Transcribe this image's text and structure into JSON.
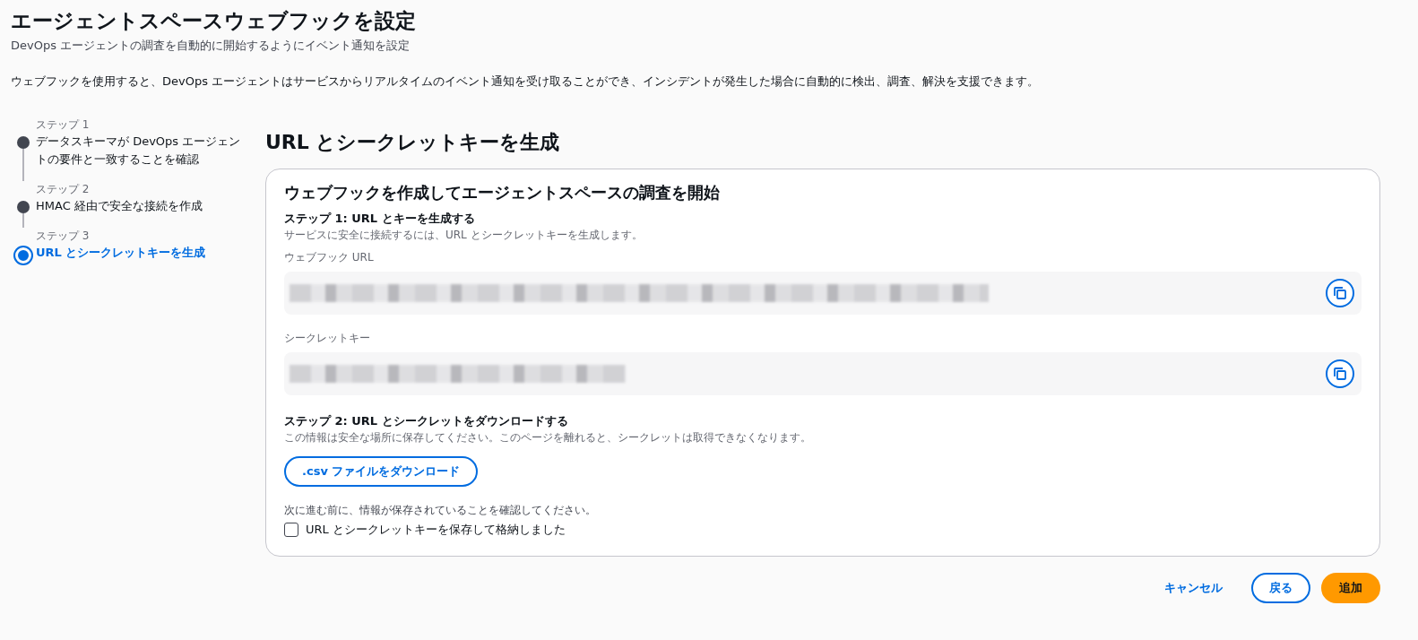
{
  "header": {
    "title": "エージェントスペースウェブフックを設定",
    "subtitle": "DevOps エージェントの調査を自動的に開始するようにイベント通知を設定",
    "description": "ウェブフックを使用すると、DevOps エージェントはサービスからリアルタイムのイベント通知を受け取ることができ、インシデントが発生した場合に自動的に検出、調査、解決を支援できます。"
  },
  "steps": [
    {
      "label": "ステップ 1",
      "title": "データスキーマが DevOps エージェントの要件と一致することを確認",
      "selected": false
    },
    {
      "label": "ステップ 2",
      "title": "HMAC 経由で安全な接続を作成",
      "selected": false
    },
    {
      "label": "ステップ 3",
      "title": "URL とシークレットキーを生成",
      "selected": true
    }
  ],
  "main": {
    "heading": "URL とシークレットキーを生成",
    "card": {
      "title": "ウェブフックを作成してエージェントスペースの調査を開始",
      "step1": {
        "title": "ステップ 1: URL とキーを生成する",
        "description": "サービスに安全に接続するには、URL とシークレットキーを生成します。"
      },
      "fields": [
        {
          "label": "ウェブフック URL"
        },
        {
          "label": "シークレットキー"
        }
      ],
      "step2": {
        "title": "ステップ 2: URL とシークレットをダウンロードする",
        "description": "この情報は安全な場所に保存してください。このページを離れると、シークレットは取得できなくなります。",
        "button": ".csv ファイルをダウンロード"
      },
      "confirm_hint": "次に進む前に、情報が保存されていることを確認してください。",
      "checkbox": {
        "label": "URL とシークレットキーを保存して格納しました",
        "checked": false
      }
    }
  },
  "footer": {
    "buttons": [
      {
        "label": "キャンセル",
        "kind": "link"
      },
      {
        "label": "戻る",
        "kind": "normal"
      },
      {
        "label": "追加",
        "kind": "primary"
      }
    ]
  }
}
